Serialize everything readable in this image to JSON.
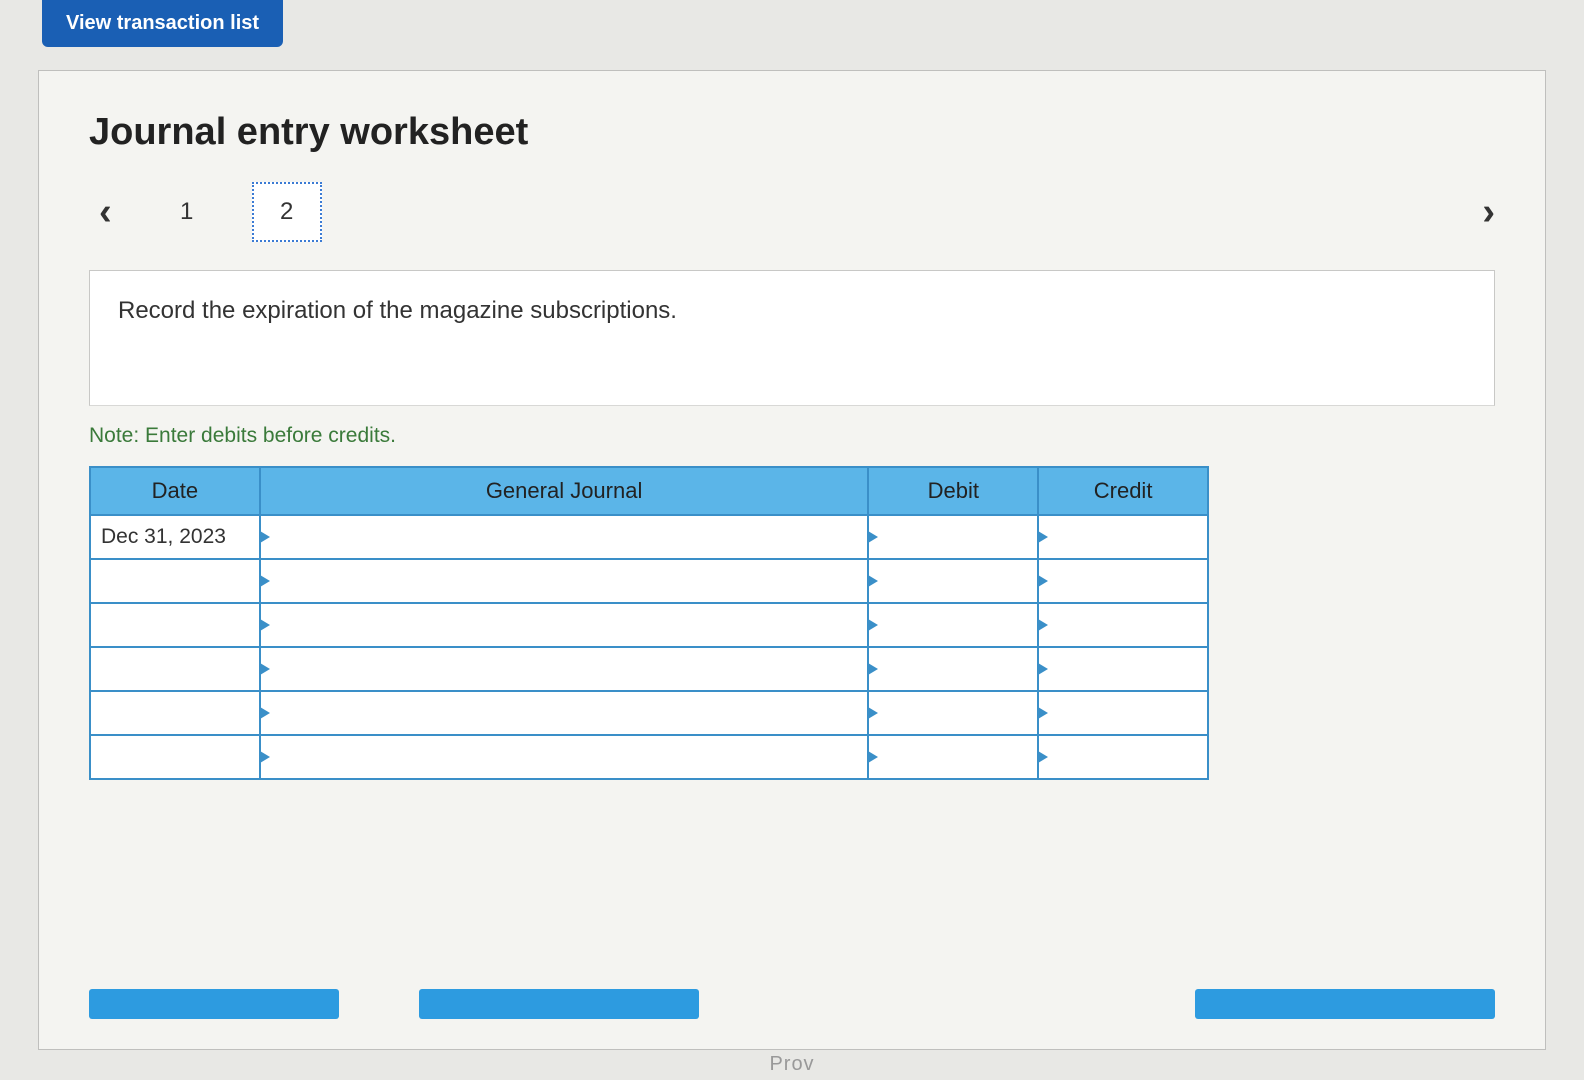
{
  "topButton": "View transaction list",
  "heading": "Journal entry worksheet",
  "pager": {
    "items": [
      "1",
      "2"
    ],
    "activeIndex": 1
  },
  "instruction": "Record the expiration of the magazine subscriptions.",
  "note": "Note: Enter debits before credits.",
  "table": {
    "headers": {
      "date": "Date",
      "gj": "General Journal",
      "debit": "Debit",
      "credit": "Credit"
    },
    "rows": [
      {
        "date": "Dec 31, 2023",
        "gj": "",
        "debit": "",
        "credit": ""
      },
      {
        "date": "",
        "gj": "",
        "debit": "",
        "credit": ""
      },
      {
        "date": "",
        "gj": "",
        "debit": "",
        "credit": ""
      },
      {
        "date": "",
        "gj": "",
        "debit": "",
        "credit": ""
      },
      {
        "date": "",
        "gj": "",
        "debit": "",
        "credit": ""
      },
      {
        "date": "",
        "gj": "",
        "debit": "",
        "credit": ""
      }
    ]
  },
  "footer": "Prov"
}
